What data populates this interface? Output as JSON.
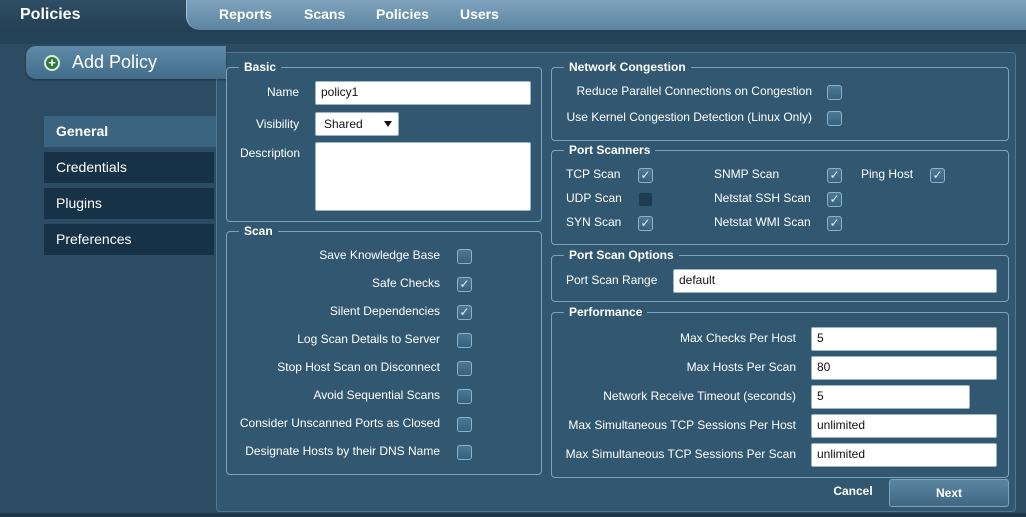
{
  "app": {
    "title": "Policies"
  },
  "nav": {
    "items": [
      "Reports",
      "Scans",
      "Policies",
      "Users"
    ]
  },
  "header": {
    "add_policy_label": "Add Policy",
    "add_icon": "plus-circle-icon"
  },
  "tabs": [
    "General",
    "Credentials",
    "Plugins",
    "Preferences"
  ],
  "basic": {
    "legend": "Basic",
    "name_label": "Name",
    "name_value": "policy1",
    "visibility_label": "Visibility",
    "visibility_value": "Shared",
    "description_label": "Description",
    "description_value": ""
  },
  "scan": {
    "legend": "Scan",
    "options": [
      {
        "label": "Save Knowledge Base",
        "checked": false
      },
      {
        "label": "Safe Checks",
        "checked": true
      },
      {
        "label": "Silent Dependencies",
        "checked": true
      },
      {
        "label": "Log Scan Details to Server",
        "checked": false
      },
      {
        "label": "Stop Host Scan on Disconnect",
        "checked": false
      },
      {
        "label": "Avoid Sequential Scans",
        "checked": false
      },
      {
        "label": "Consider Unscanned Ports as Closed",
        "checked": false
      },
      {
        "label": "Designate Hosts by their DNS Name",
        "checked": false
      }
    ]
  },
  "network_congestion": {
    "legend": "Network Congestion",
    "options": [
      {
        "label": "Reduce Parallel Connections on Congestion",
        "checked": false
      },
      {
        "label": "Use Kernel Congestion Detection (Linux Only)",
        "checked": false
      }
    ]
  },
  "port_scanners": {
    "legend": "Port Scanners",
    "options": [
      {
        "label": "TCP Scan",
        "checked": true
      },
      {
        "label": "SNMP Scan",
        "checked": true
      },
      {
        "label": "Ping Host",
        "checked": true
      },
      {
        "label": "UDP Scan",
        "checked": false
      },
      {
        "label": "Netstat SSH Scan",
        "checked": true
      },
      {
        "label": "SYN Scan",
        "checked": true
      },
      {
        "label": "Netstat WMI Scan",
        "checked": true
      }
    ]
  },
  "port_scan_options": {
    "legend": "Port Scan Options",
    "range_label": "Port Scan Range",
    "range_value": "default"
  },
  "performance": {
    "legend": "Performance",
    "fields": [
      {
        "label": "Max Checks Per Host",
        "value": "5"
      },
      {
        "label": "Max Hosts Per Scan",
        "value": "80"
      },
      {
        "label": "Network Receive Timeout (seconds)",
        "value": "5"
      },
      {
        "label": "Max Simultaneous TCP Sessions Per Host",
        "value": "unlimited"
      },
      {
        "label": "Max Simultaneous TCP Sessions Per Scan",
        "value": "unlimited"
      }
    ]
  },
  "actions": {
    "cancel_label": "Cancel",
    "next_label": "Next"
  },
  "check_glyph": "✓"
}
